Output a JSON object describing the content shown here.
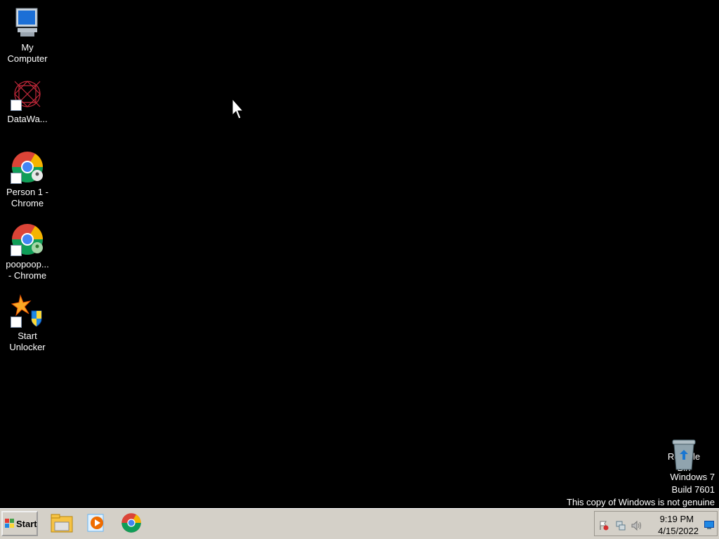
{
  "desktop": {
    "icons": [
      {
        "label": "My\nComputer"
      },
      {
        "label": "DataWa..."
      },
      {
        "label": "Person 1 -\nChrome"
      },
      {
        "label": "poopoop...\n- Chrome"
      },
      {
        "label": "Start\nUnlocker"
      }
    ],
    "recycle_bin": {
      "label": "Recycle\nBin"
    },
    "watermark": {
      "line1": "Windows 7",
      "line2": "Build 7601",
      "line3": "This copy of Windows is not genuine"
    }
  },
  "taskbar": {
    "start_label": "Start",
    "pinned": [
      {
        "icon": "file-explorer-icon"
      },
      {
        "icon": "media-player-icon"
      },
      {
        "icon": "chrome-icon"
      }
    ],
    "tray": {
      "time": "9:19 PM",
      "date": "4/15/2022",
      "icons": [
        "action-center-flag-icon",
        "network-icon",
        "volume-icon",
        "show-desktop-icon"
      ]
    }
  }
}
